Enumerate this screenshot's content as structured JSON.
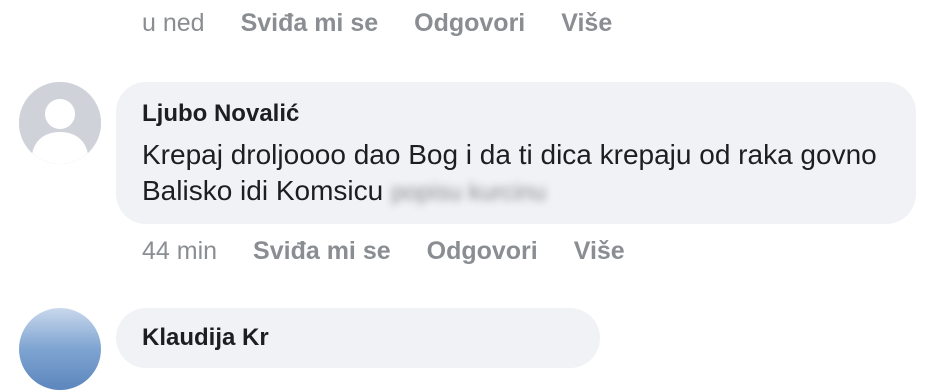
{
  "previous_comment": {
    "time": "u ned",
    "like": "Sviđa mi se",
    "reply": "Odgovori",
    "more": "Više"
  },
  "comment": {
    "author": "Ljubo Novalić",
    "text": "Krepaj droljoooo dao Bog i da ti dica krepaju od raka govno Balisko idi Komsicu",
    "blurred_text": "popisu kurcinu",
    "time": "44 min",
    "like": "Sviđa mi se",
    "reply": "Odgovori",
    "more": "Više"
  },
  "next_comment": {
    "author": "Klaudija Kr"
  }
}
